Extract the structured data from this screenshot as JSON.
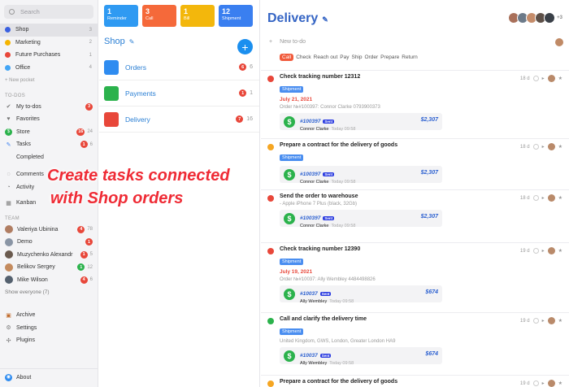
{
  "sidebar": {
    "search_placeholder": "Search",
    "pockets": [
      {
        "label": "Shop",
        "count": "3",
        "color": "#3a60e0"
      },
      {
        "label": "Marketing",
        "count": "2",
        "color": "#f5b400"
      },
      {
        "label": "Future Purchases",
        "count": "1",
        "color": "#e8473a"
      },
      {
        "label": "Office",
        "count": "4",
        "color": "#42a5f5"
      }
    ],
    "new_pocket": "+ New pocket",
    "todos_header": "TO-DOS",
    "todos": [
      {
        "label": "My to-dos",
        "badge": "3",
        "badge_color": "#e8473a",
        "count": ""
      },
      {
        "label": "Favorites",
        "badge": "",
        "badge_color": "",
        "count": ""
      },
      {
        "label": "Store",
        "badge": "16",
        "badge_color": "#e8473a",
        "count": "24"
      },
      {
        "label": "Tasks",
        "badge": "1",
        "badge_color": "#e8473a",
        "count": "6"
      },
      {
        "label": "Completed",
        "badge": "",
        "badge_color": "",
        "count": ""
      }
    ],
    "extra": [
      "Comments",
      "Activity",
      "Kanban"
    ],
    "team_header": "TEAM",
    "team": [
      {
        "name": "Valeriya Ubinina",
        "badge": "4",
        "badge_color": "#e8473a",
        "count": "78"
      },
      {
        "name": "Demo",
        "badge": "1",
        "badge_color": "#e8473a",
        "count": ""
      },
      {
        "name": "Muzychenko Alexandr",
        "badge": "1",
        "badge_color": "#e8473a",
        "count": "5"
      },
      {
        "name": "Belikov Sergey",
        "badge": "1",
        "badge_color": "#2bb24c",
        "count": "12"
      },
      {
        "name": "Mike Wilson",
        "badge": "4",
        "badge_color": "#e8473a",
        "count": "6"
      }
    ],
    "show_everyone": "Show everyone (7)",
    "bottom": [
      "Archive",
      "Settings",
      "Plugins"
    ],
    "about": "About"
  },
  "shop": {
    "cards": [
      {
        "num": "1",
        "label": "Reminder",
        "color": "#2f9af2"
      },
      {
        "num": "3",
        "label": "Call",
        "color": "#f5693a"
      },
      {
        "num": "1",
        "label": "Bill",
        "color": "#f3b70c"
      },
      {
        "num": "12",
        "label": "Shipment",
        "color": "#3a7ff0"
      }
    ],
    "title": "Shop",
    "add": "+",
    "rows": [
      {
        "label": "Orders",
        "badge": "6",
        "count": "6",
        "icon_color": "#2f8cf0"
      },
      {
        "label": "Payments",
        "badge": "1",
        "count": "1",
        "icon_color": "#2bb24c"
      },
      {
        "label": "Delivery",
        "badge": "7",
        "count": "16",
        "icon_color": "#e8473a"
      }
    ]
  },
  "overlay": {
    "line1": "Create tasks connected",
    "line2": "with Shop orders"
  },
  "main": {
    "title": "Delivery",
    "avatar_more": "+3",
    "new_todo_placeholder": "New to-do",
    "filters": [
      "Call",
      "Check",
      "Reach out",
      "Pay",
      "Ship",
      "Order",
      "Prepare",
      "Return"
    ],
    "tasks": [
      {
        "title": "Check tracking number 12312",
        "tag": "Shipment",
        "date": "July 21, 2021",
        "sub": "Order №#100397: Connor Clarke 0793900373",
        "order": "#100397",
        "customer": "Connor Clarke",
        "when": "Today 09:58",
        "amount": "$2,307",
        "age": "18 d",
        "status": "#e8473a"
      },
      {
        "title": "Prepare a contract for the delivery of goods",
        "tag": "Shipment",
        "date": "",
        "sub": "",
        "order": "#100397",
        "customer": "Connor Clarke",
        "when": "Today 09:58",
        "amount": "$2,307",
        "age": "18 d",
        "status": "#f5a623"
      },
      {
        "title": "Send the order to warehouse",
        "tag": "",
        "date": "",
        "sub": "- Apple iPhone 7 Plus (black, 32Gb)",
        "order": "#100397",
        "customer": "Connor Clarke",
        "when": "Today 09:58",
        "amount": "$2,307",
        "age": "18 d",
        "status": "#e8473a"
      },
      {
        "title": "Check tracking number 12390",
        "tag": "Shipment",
        "date": "July 19, 2021",
        "sub": "Order №#10037: Ally Wembley 4484498826",
        "order": "#10037",
        "customer": "Ally Wembley",
        "when": "Today 09:58",
        "amount": "$674",
        "age": "19 d",
        "status": "#e8473a"
      },
      {
        "title": "Call and clarify the delivery time",
        "tag": "Shipment",
        "date": "",
        "sub": "United Kingdom, GWS, London, Greater London HA9",
        "order": "#10037",
        "customer": "Ally Wembley",
        "when": "Today 09:58",
        "amount": "$674",
        "age": "19 d",
        "status": "#2bb24c"
      },
      {
        "title": "Prepare a contract for the delivery of goods",
        "tag": "",
        "date": "",
        "sub": "",
        "order": "",
        "customer": "",
        "when": "",
        "amount": "",
        "age": "19 d",
        "status": "#f5a623"
      }
    ],
    "sent_label": "Sent"
  }
}
